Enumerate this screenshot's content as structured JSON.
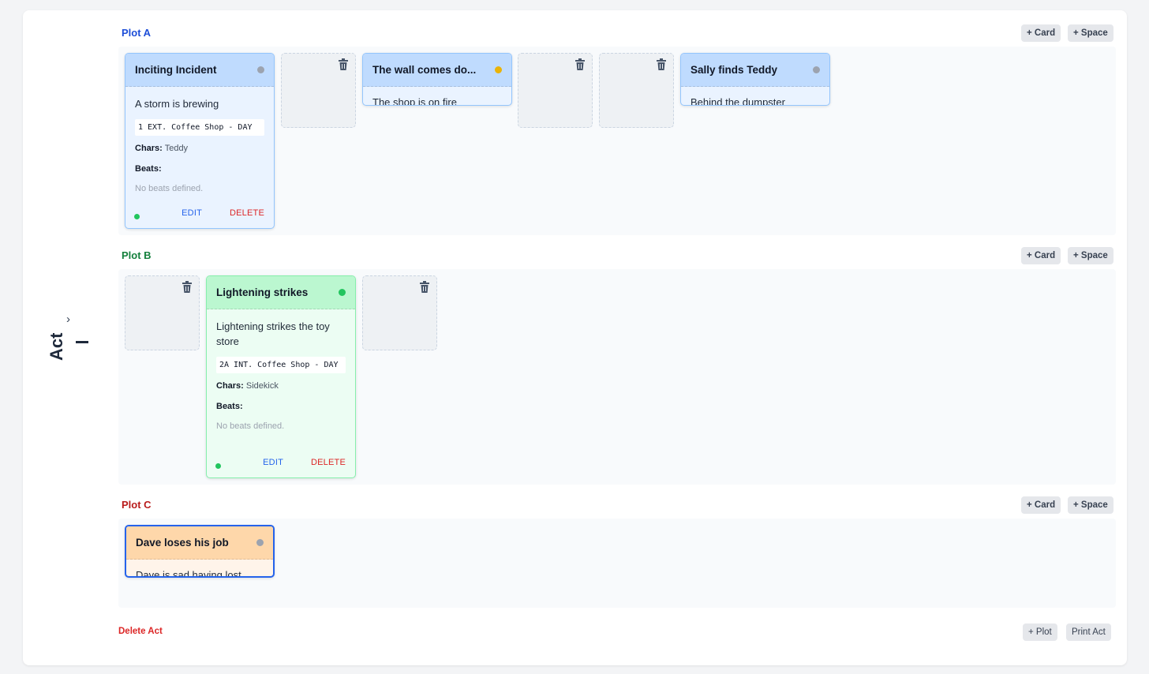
{
  "colors": {
    "plot_a": "#1d4ed8",
    "plot_b": "#15803d",
    "plot_c": "#b91c1c",
    "blue_head": "#bfdbfe",
    "blue_body": "#eaf3ff",
    "green_head": "#bbf7d0",
    "green_body": "#ecfdf3",
    "orange_head": "#fed7aa",
    "orange_body": "#fff4ea",
    "status_gray": "#9ca3af",
    "status_yellow": "#eab308",
    "status_green": "#22c55e"
  },
  "act": {
    "label": "Act",
    "number": "I"
  },
  "plots": [
    {
      "title": "Plot A",
      "add_card": "+ Card",
      "add_space": "+ Space",
      "cards": [
        {
          "title": "Inciting Incident",
          "status": "gray",
          "desc": "A storm is brewing",
          "slug": "1 EXT. Coffee Shop - DAY",
          "chars_label": "Chars:",
          "chars": "Teddy",
          "beats_label": "Beats:",
          "beats_empty": "No beats defined.",
          "edit": "EDIT",
          "delete": "DELETE"
        },
        {
          "title": "The wall comes do...",
          "status": "yellow",
          "desc": "The shop is on fire"
        },
        {
          "title": "Sally finds Teddy",
          "status": "gray",
          "desc": "Behind the dumpster"
        }
      ]
    },
    {
      "title": "Plot B",
      "add_card": "+ Card",
      "add_space": "+ Space",
      "cards": [
        {
          "title": "Lightening strikes",
          "status": "green",
          "desc": "Lightening strikes the toy store",
          "slug": "2A INT. Coffee Shop - DAY",
          "chars_label": "Chars:",
          "chars": "Sidekick",
          "beats_label": "Beats:",
          "beats_empty": "No beats defined.",
          "edit": "EDIT",
          "delete": "DELETE"
        }
      ]
    },
    {
      "title": "Plot C",
      "add_card": "+ Card",
      "add_space": "+ Space",
      "cards": [
        {
          "title": "Dave loses his job",
          "status": "gray",
          "desc": "Dave is sad having lost"
        }
      ]
    }
  ],
  "footer": {
    "delete_act": "Delete Act",
    "add_plot": "+ Plot",
    "print_act": "Print Act"
  }
}
